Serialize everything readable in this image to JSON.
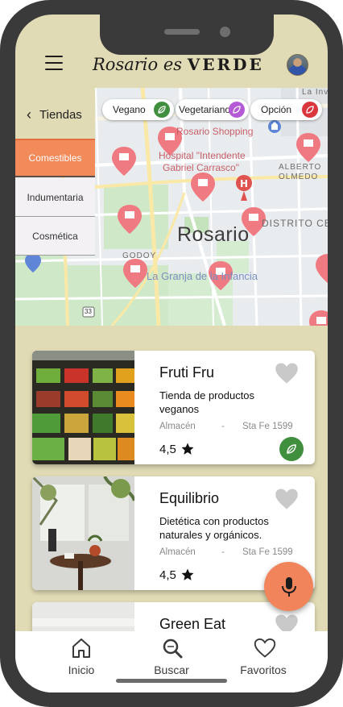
{
  "header": {
    "brand_script": "Rosario es ",
    "brand_strong": "VERDE"
  },
  "map": {
    "city_label": "Rosario",
    "labels": {
      "rosario_shopping": "Rosario Shopping",
      "hospital_1": "Hospital \"Intendente",
      "hospital_2": "Gabriel Carrasco\"",
      "alberto": "ALBERTO",
      "olmedo": "OLMEDO",
      "distrito": "DISTRITO CEN",
      "godoy": "GODOY",
      "granja": "La Granja de la Infancia",
      "la_inv": "La Inv",
      "route": "33"
    }
  },
  "filters": [
    {
      "label": "Vegano",
      "color": "#3f8f3f"
    },
    {
      "label": "Vegetariano",
      "color": "#b45ad6"
    },
    {
      "label": "Opción",
      "color": "#d9363e"
    }
  ],
  "sidebar": {
    "back_label": "Tiendas",
    "items": [
      {
        "label": "Comestibles",
        "active": true
      },
      {
        "label": "Indumentaria",
        "active": false
      },
      {
        "label": "Cosmética",
        "active": false
      }
    ]
  },
  "stores": [
    {
      "name": "Fruti Fru",
      "description": "Tienda de productos veganos",
      "category": "Almacén",
      "separator": "-",
      "address": "Sta Fe 1599",
      "rating": "4,5"
    },
    {
      "name": "Equilibrio",
      "description": "Dietética con productos naturales y orgánicos.",
      "category": "Almacén",
      "separator": "-",
      "address": "Sta Fe 1599",
      "rating": "4,5"
    },
    {
      "name": "Green Eat"
    }
  ],
  "nav": {
    "home": "Inicio",
    "search": "Buscar",
    "favorites": "Favoritos"
  },
  "colors": {
    "background": "#e1dbb5",
    "accent": "#f28a5a",
    "vegan_green": "#3f8f3f",
    "pin": "#f07a82"
  },
  "icons": [
    "menu-icon",
    "chevron-left-icon",
    "heart-icon",
    "star-icon",
    "leaf-icon",
    "microphone-icon",
    "home-icon",
    "search-icon",
    "heart-outline-icon",
    "map-pin-icon"
  ]
}
